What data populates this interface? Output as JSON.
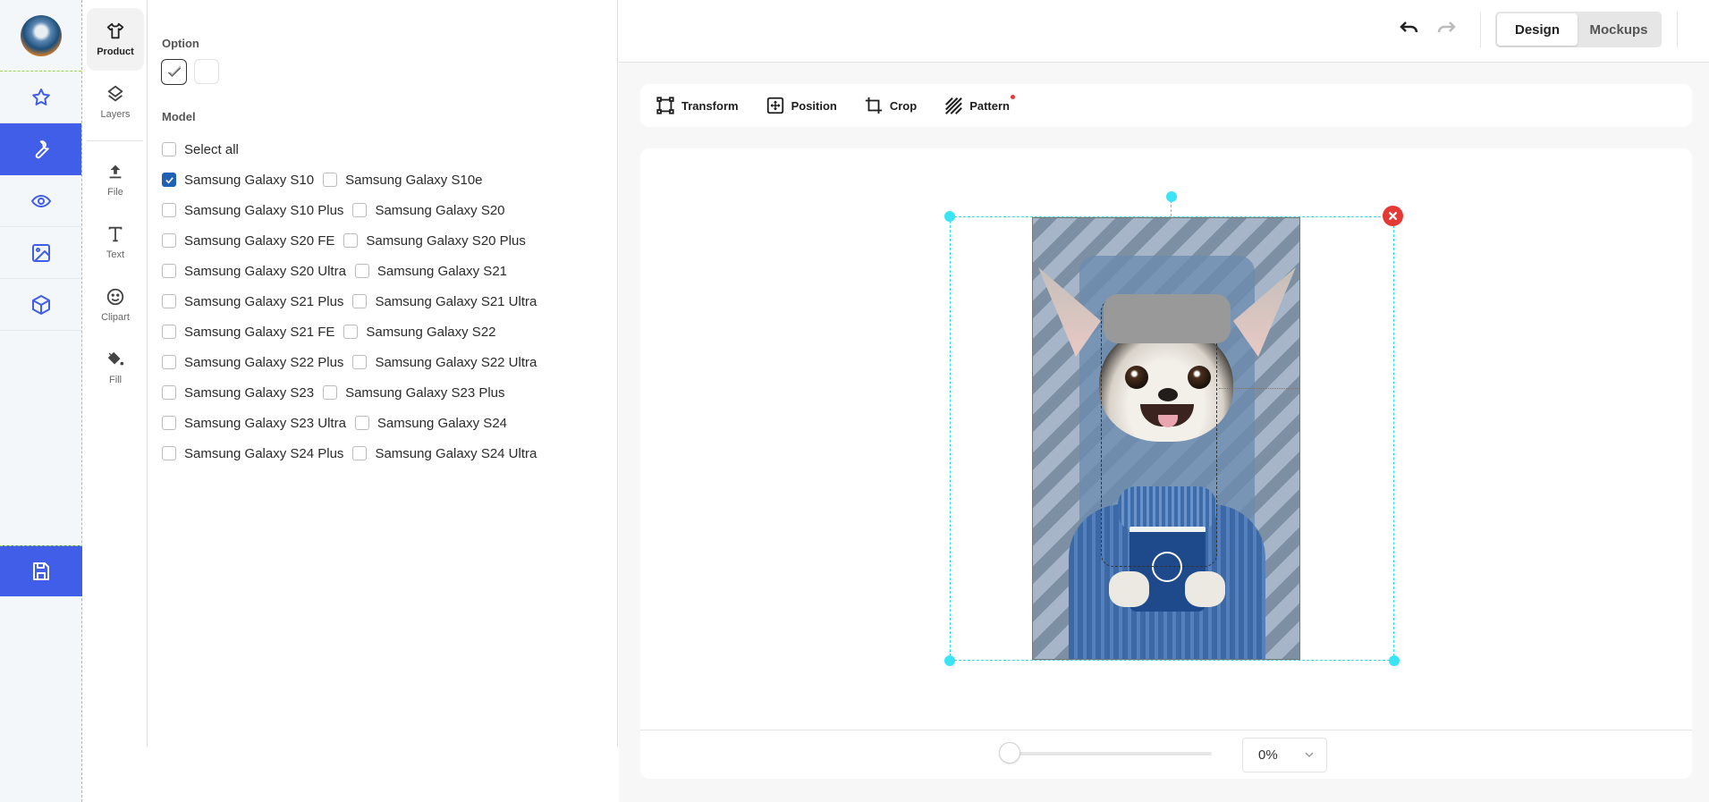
{
  "nav": {
    "avatar_alt": "user avatar",
    "items": [
      {
        "name": "favorites",
        "icon": "star-icon",
        "active": false
      },
      {
        "name": "tools",
        "icon": "wrench-icon",
        "active": true
      },
      {
        "name": "preview",
        "icon": "eye-icon",
        "active": false
      },
      {
        "name": "images",
        "icon": "image-icon",
        "active": false
      },
      {
        "name": "3d",
        "icon": "cube-icon",
        "active": false
      }
    ],
    "save_icon": "save-icon"
  },
  "rail": {
    "items": [
      {
        "label": "Product",
        "icon": "tshirt-icon",
        "active": true
      },
      {
        "label": "Layers",
        "icon": "layers-icon",
        "active": false
      },
      {
        "label": "File",
        "icon": "upload-icon",
        "active": false
      },
      {
        "label": "Text",
        "icon": "text-icon",
        "active": false
      },
      {
        "label": "Clipart",
        "icon": "smiley-icon",
        "active": false
      },
      {
        "label": "Fill",
        "icon": "paint-bucket-icon",
        "active": false
      }
    ]
  },
  "panel": {
    "option_title": "Option",
    "options": [
      {
        "name": "glossy",
        "selected": true
      },
      {
        "name": "white",
        "selected": false
      }
    ],
    "model_title": "Model",
    "select_all": {
      "label": "Select all",
      "checked": false
    },
    "model_rows": [
      [
        {
          "label": "Samsung Galaxy S10",
          "checked": true
        },
        {
          "label": "Samsung Galaxy S10e",
          "checked": false
        }
      ],
      [
        {
          "label": "Samsung Galaxy S10 Plus",
          "checked": false
        },
        {
          "label": "Samsung Galaxy S20",
          "checked": false
        }
      ],
      [
        {
          "label": "Samsung Galaxy S20 FE",
          "checked": false
        },
        {
          "label": "Samsung Galaxy S20 Plus",
          "checked": false
        }
      ],
      [
        {
          "label": "Samsung Galaxy S20 Ultra",
          "checked": false
        },
        {
          "label": "Samsung Galaxy S21",
          "checked": false
        }
      ],
      [
        {
          "label": "Samsung Galaxy S21 Plus",
          "checked": false
        },
        {
          "label": "Samsung Galaxy S21 Ultra",
          "checked": false
        }
      ],
      [
        {
          "label": "Samsung Galaxy S21 FE",
          "checked": false
        },
        {
          "label": "Samsung Galaxy S22",
          "checked": false
        }
      ],
      [
        {
          "label": "Samsung Galaxy S22 Plus",
          "checked": false
        },
        {
          "label": "Samsung Galaxy S22 Ultra",
          "checked": false
        }
      ],
      [
        {
          "label": "Samsung Galaxy S23",
          "checked": false
        },
        {
          "label": "Samsung Galaxy S23 Plus",
          "checked": false
        }
      ],
      [
        {
          "label": "Samsung Galaxy S23 Ultra",
          "checked": false
        },
        {
          "label": "Samsung Galaxy S24",
          "checked": false
        }
      ],
      [
        {
          "label": "Samsung Galaxy S24 Plus",
          "checked": false
        },
        {
          "label": "Samsung Galaxy S24 Ultra",
          "checked": false
        }
      ]
    ]
  },
  "header": {
    "undo_icon": "undo-icon",
    "redo_icon": "redo-icon",
    "tabs": [
      {
        "label": "Design",
        "active": true
      },
      {
        "label": "Mockups",
        "active": false
      }
    ]
  },
  "toolbar": {
    "tools": [
      {
        "label": "Transform",
        "icon": "transform-icon",
        "badge": false
      },
      {
        "label": "Position",
        "icon": "position-icon",
        "badge": false
      },
      {
        "label": "Crop",
        "icon": "crop-icon",
        "badge": false
      },
      {
        "label": "Pattern",
        "icon": "pattern-icon",
        "badge": true
      }
    ]
  },
  "canvas": {
    "zoom_slider_value": 0,
    "zoom_select_value": "0%",
    "design_description": "Chihuahua in blue sweater holding coffee cup on diagonal striped phone case",
    "colors": {
      "accent": "#405ee8",
      "checkbox_on": "#1f62b5",
      "selection": "#35d9f0",
      "delete": "#e53935",
      "pattern_badge": "#e53935"
    }
  }
}
